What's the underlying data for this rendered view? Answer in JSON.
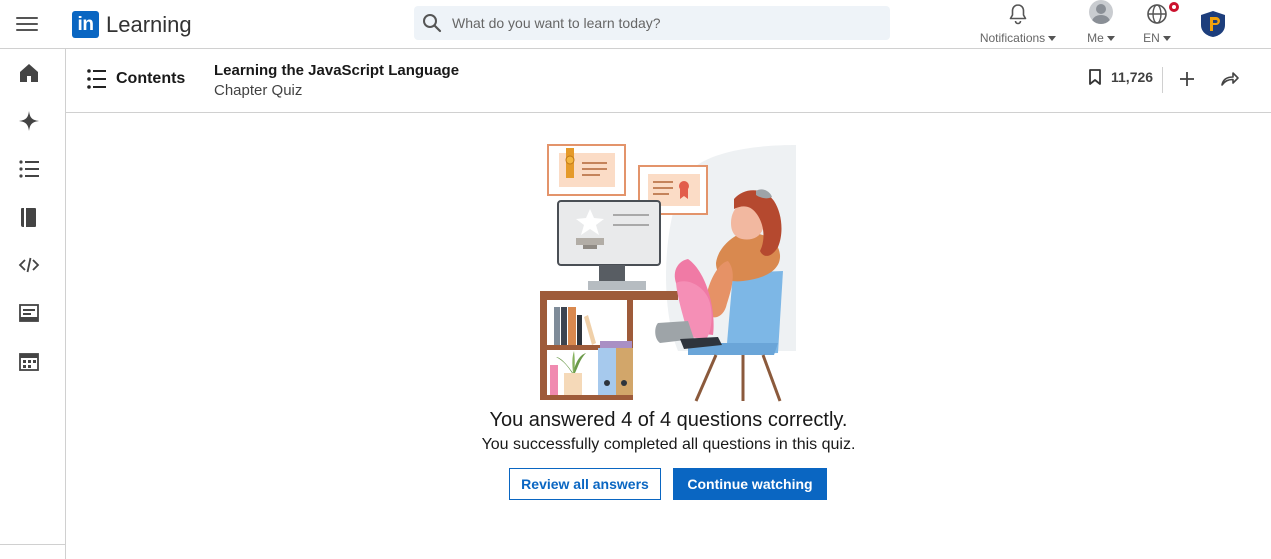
{
  "topnav": {
    "logo_letters": "in",
    "logo_text": "Learning",
    "search_placeholder": "What do you want to learn today?",
    "notifications_label": "Notifications",
    "me_label": "Me",
    "language_label": "EN"
  },
  "sidebar": {
    "items": [
      {
        "icon": "home-icon"
      },
      {
        "icon": "sparkle-icon"
      },
      {
        "icon": "list-icon"
      },
      {
        "icon": "book-icon"
      },
      {
        "icon": "code-icon"
      },
      {
        "icon": "certificate-icon"
      },
      {
        "icon": "calendar-icon"
      }
    ]
  },
  "content_header": {
    "contents_label": "Contents",
    "course_title": "Learning the JavaScript Language",
    "section_title": "Chapter Quiz",
    "saved_count": "11,726"
  },
  "quiz_result": {
    "title": "You answered 4 of 4 questions correctly.",
    "subtitle": "You successfully completed all questions in this quiz.",
    "review_button": "Review all answers",
    "continue_button": "Continue watching"
  },
  "colors": {
    "brand_blue": "#0a66c2",
    "badge_red": "#cb112d"
  }
}
